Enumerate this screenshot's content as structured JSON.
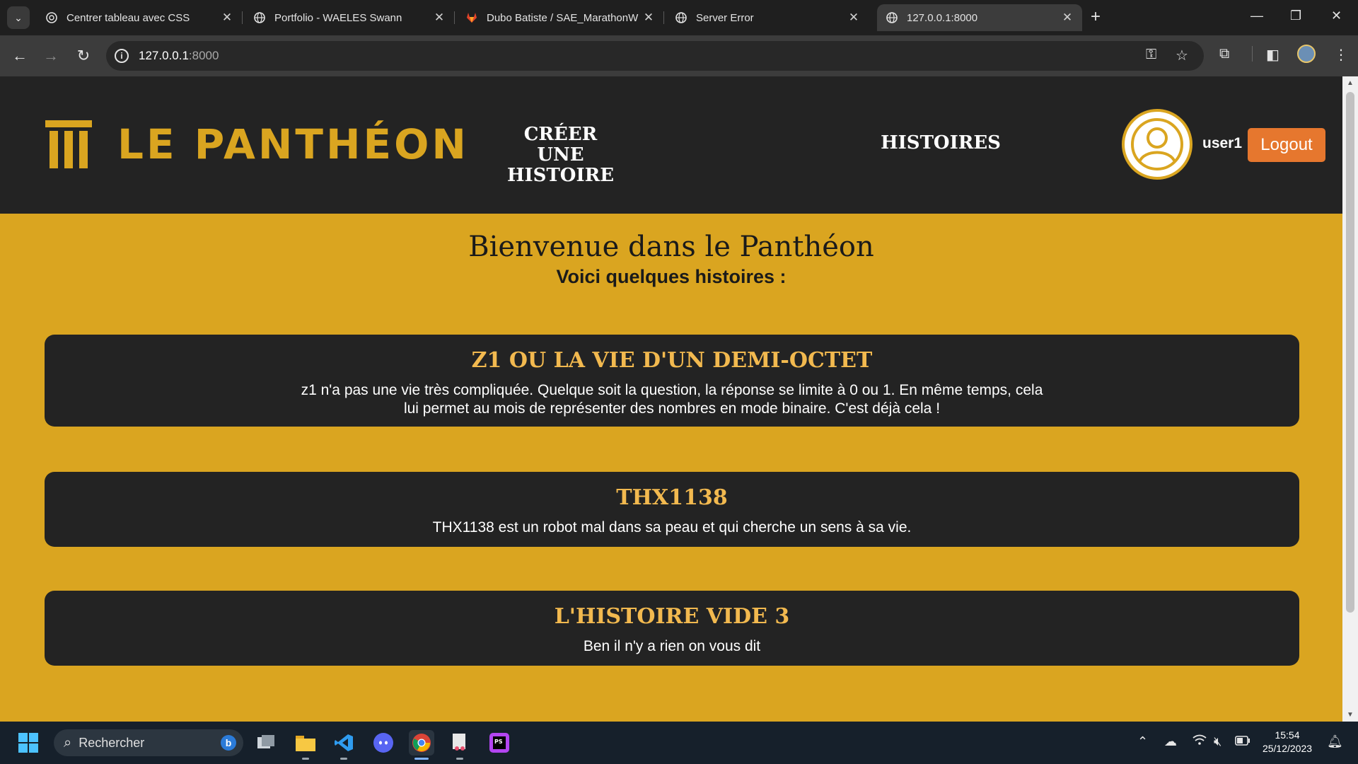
{
  "browser": {
    "tabs": [
      {
        "title": "Centrer tableau avec CSS",
        "icon": "chatgpt-icon"
      },
      {
        "title": "Portfolio - WAELES Swann",
        "icon": "globe-icon"
      },
      {
        "title": "Dubo Batiste / SAE_MarathonW",
        "icon": "gitlab-icon"
      },
      {
        "title": "Server Error",
        "icon": "globe-icon"
      },
      {
        "title": "127.0.0.1:8000",
        "icon": "globe-icon"
      }
    ],
    "url_host": "127.0.0.1",
    "url_port": ":8000"
  },
  "site": {
    "logo_text": "LE PANTHÉON",
    "nav": {
      "create_line1": "CRÉER UNE",
      "create_line2": "HISTOIRE",
      "histoires": "HISTOIRES"
    },
    "username": "user1",
    "logout_label": "Logout",
    "welcome": "Bienvenue dans le Panthéon",
    "subtitle": "Voici quelques histoires :",
    "stories": [
      {
        "title": "Z1 OU LA VIE D'UN DEMI-OCTET",
        "description": "z1 n'a pas une vie très compliquée. Quelque soit la question, la réponse se limite à 0 ou 1. En même temps, cela lui permet au mois de représenter des nombres en mode binaire. C'est déjà cela !"
      },
      {
        "title": "THX1138",
        "description": "THX1138 est un robot mal dans sa peau et qui cherche un sens à sa vie."
      },
      {
        "title": "L'HISTOIRE VIDE 3",
        "description": "Ben il n'y a rien on vous dit"
      }
    ]
  },
  "taskbar": {
    "search_placeholder": "Rechercher",
    "time": "15:54",
    "date": "25/12/2023"
  },
  "colors": {
    "gold": "#daa520",
    "dark": "#232323",
    "logout": "#e6772e",
    "story_title": "#f2b94f"
  }
}
